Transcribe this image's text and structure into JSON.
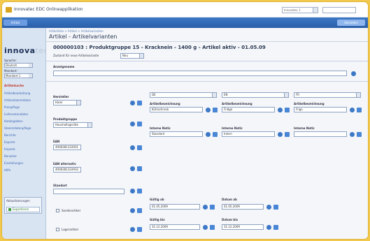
{
  "topbar": {
    "title": "Innovatec EDC Onlineapplikation",
    "select_value": "Innovatec 1",
    "search_value": ""
  },
  "bluebar": {
    "tab_label": "Artikel",
    "button_label": "Abmelden"
  },
  "sidebar": {
    "brand": "innova",
    "brand_suffix": "tec",
    "label_1": "Sprache:",
    "select_1": "Deutsch",
    "label_2": "Mandant:",
    "select_2": "Mandant 1",
    "items": [
      {
        "label": "Artikelsuche",
        "active": true
      },
      {
        "label": "Artikelbearbeitung"
      },
      {
        "label": "Artikelstammdaten"
      },
      {
        "label": "Preispflege"
      },
      {
        "label": "Lieferantendaten"
      },
      {
        "label": "Katalogdaten"
      },
      {
        "label": "Stammdatenpflege"
      },
      {
        "label": "Berichte"
      },
      {
        "label": "Exporte"
      },
      {
        "label": "Importe"
      },
      {
        "label": "Benutzer"
      },
      {
        "label": "Einstellungen"
      },
      {
        "label": "Hilfe"
      }
    ],
    "panel_title": "Aktualisierungen",
    "panel_button": "Exportieren"
  },
  "main": {
    "breadcrumb": "Artikelliste > Artikel > Artikelvarianten",
    "page_title": "Artikel - Artikelvarianten",
    "article_heading": "000000103 : Produktgruppe 15 - Kracknein - 1400 g - Artikel aktiv - 01.05.09",
    "state_label": "Zustand für neue Artikelvariante",
    "state_value": "Neu",
    "name_label": "Anzeigename",
    "name_value": "",
    "herst_label": "Hersteller",
    "herst_value": "Haier",
    "pgrp_label": "Produktgruppe",
    "pgrp_value": "Haushaltsgeräte",
    "ean_label": "EAN",
    "ean_value": "4006381333931",
    "ean2_label": "EAN alternativ",
    "ean2_value": "4006381333932",
    "loc_label": "Standort",
    "loc_value": "",
    "cb1_label": "Sonderartikel",
    "cb2_label": "Lagerartikel",
    "columns": [
      {
        "select": "DE",
        "label": "Artikelbezeichnung",
        "value": "Kühlschrank"
      },
      {
        "select": "EN",
        "label": "Artikelbezeichnung",
        "value": "Fridge"
      },
      {
        "select": "FR",
        "label": "Artikelbezeichnung",
        "value": "Frigo"
      }
    ],
    "internal_label": "Interne Notiz",
    "internal_values": [
      "Standard",
      "Intern",
      ""
    ],
    "valid_label_1": "Gültig ab",
    "valid_value_1": "01.05.2009",
    "date_label_1": "Datum ab",
    "date_value_1": "01.05.2009",
    "valid_label_2": "Gültig bis",
    "valid_value_2": "31.12.2009",
    "date_label_2": "Datum bis",
    "date_value_2": "31.12.2009"
  }
}
